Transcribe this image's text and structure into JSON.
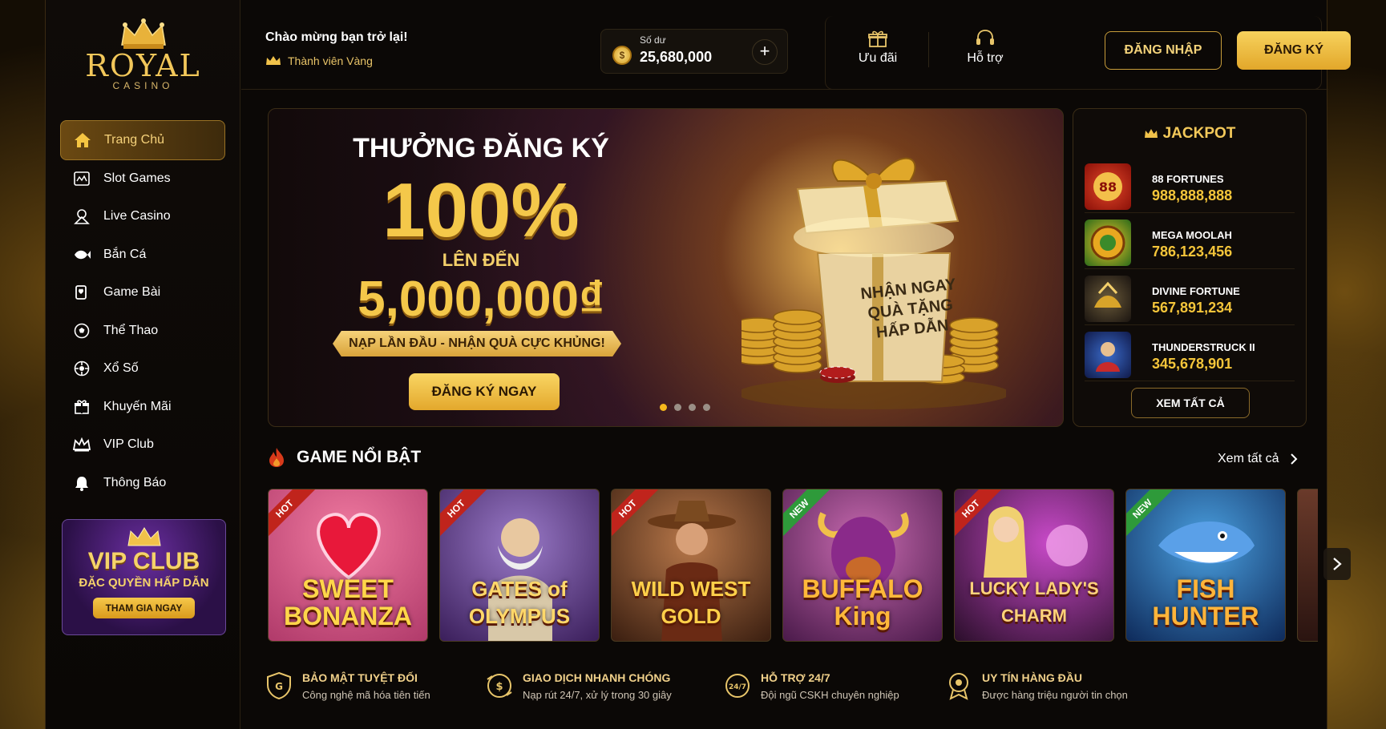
{
  "brand": {
    "name": "ROYAL",
    "sub": "CASINO"
  },
  "header": {
    "welcome": "Chào mừng bạn trở lại!",
    "member_level": "Thành viên Vàng",
    "balance_label": "Số dư",
    "balance_value": "25,680,000",
    "plus": "+",
    "offers_label": "Ưu đãi",
    "support_label": "Hỗ trợ",
    "login_label": "ĐĂNG NHẬP",
    "register_label": "ĐĂNG KÝ"
  },
  "sidebar": {
    "items": [
      {
        "label": "Trang Chủ",
        "icon": "home-icon",
        "active": true
      },
      {
        "label": "Slot Games",
        "icon": "slot-icon"
      },
      {
        "label": "Live Casino",
        "icon": "live-casino-icon"
      },
      {
        "label": "Bắn Cá",
        "icon": "fish-icon"
      },
      {
        "label": "Game Bài",
        "icon": "cards-icon"
      },
      {
        "label": "Thể Thao",
        "icon": "soccer-ball-icon"
      },
      {
        "label": "Xổ Số",
        "icon": "lottery-icon"
      },
      {
        "label": "Khuyến Mãi",
        "icon": "gift-icon"
      },
      {
        "label": "VIP Club",
        "icon": "crown-icon"
      },
      {
        "label": "Thông Báo",
        "icon": "bell-icon"
      }
    ],
    "vip_promo": {
      "title": "VIP CLUB",
      "subtitle": "ĐẶC QUYỀN HẤP DẪN",
      "button": "THAM GIA NGAY"
    }
  },
  "banner": {
    "line1": "THƯỞNG ĐĂNG KÝ",
    "line2": "100%",
    "line3": "LÊN ĐẾN",
    "line4": "5,000,000₫",
    "ribbon": "NẠP LẦN ĐẦU - NHẬN QUÀ CỰC KHỦNG!",
    "button": "ĐĂNG KÝ NGAY",
    "gift_card": "NHẬN NGAY QUÀ TẶNG HẤP DẪN",
    "slides": 4,
    "active_slide": 1
  },
  "jackpot": {
    "title": "JACKPOT",
    "items": [
      {
        "name": "88 FORTUNES",
        "value": "988,888,888"
      },
      {
        "name": "MEGA MOOLAH",
        "value": "786,123,456"
      },
      {
        "name": "DIVINE FORTUNE",
        "value": "567,891,234"
      },
      {
        "name": "THUNDERSTRUCK II",
        "value": "345,678,901"
      }
    ],
    "button": "XEM TẤT CẢ"
  },
  "featured": {
    "title": "GAME NỔI BẬT",
    "see_all": "Xem tất cả",
    "games": [
      {
        "name": "SWEET BONANZA",
        "badge": "HOT",
        "bg": "#d9577a",
        "text_color": "#ffd64a"
      },
      {
        "name": "GATES of OLYMPUS",
        "badge": "HOT",
        "bg": "#5a3a8a",
        "text_color": "#ffd86a"
      },
      {
        "name": "WILD WEST GOLD",
        "badge": "HOT",
        "bg": "#8a4a2a",
        "text_color": "#ffd04a"
      },
      {
        "name": "BUFFALO King",
        "badge": "NEW",
        "bg": "#7a3a8a",
        "text_color": "#ffb83a"
      },
      {
        "name": "LUCKY LADY'S CHARM",
        "badge": "HOT",
        "bg": "#3a1a3a",
        "text_color": "#ffd27a"
      },
      {
        "name": "FISH HUNTER",
        "badge": "NEW",
        "bg": "#1c6aa8",
        "text_color": "#ffb43a"
      }
    ]
  },
  "trust": [
    {
      "title": "BẢO MẬT TUYỆT ĐỐI",
      "sub": "Công nghệ mã hóa tiên tiến"
    },
    {
      "title": "GIAO DỊCH NHANH CHÓNG",
      "sub": "Nạp rút 24/7, xử lý trong 30 giây"
    },
    {
      "title": "HỖ TRỢ 24/7",
      "sub": "Đội ngũ CSKH chuyên nghiệp"
    },
    {
      "title": "UY TÍN HÀNG ĐẦU",
      "sub": "Được hàng triệu người tin chọn"
    }
  ],
  "colors": {
    "gold": "#f3c95a",
    "accent": "#e2a72a",
    "background": "#0b0806"
  }
}
